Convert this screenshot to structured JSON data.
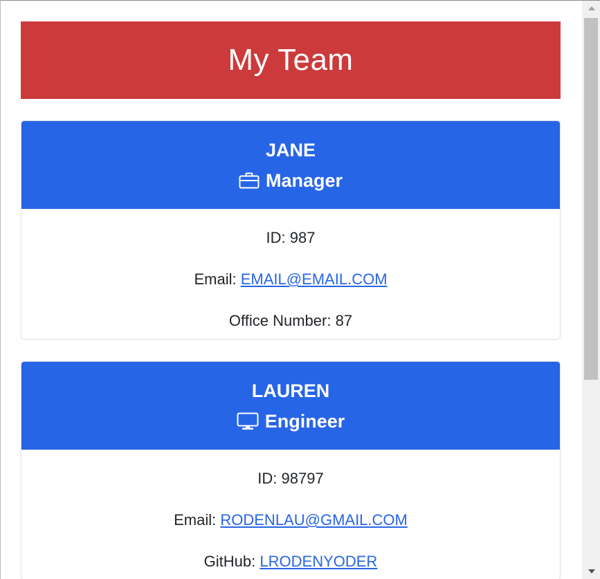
{
  "banner": {
    "title": "My Team"
  },
  "colors": {
    "banner": "#cc3a3b",
    "card_header": "#2765e7",
    "link": "#2765e7"
  },
  "cards": [
    {
      "name": "JANE",
      "role": "Manager",
      "role_icon": "briefcase-icon",
      "id_label": "ID:",
      "id": "987",
      "email_label": "Email:",
      "email": "EMAIL@EMAIL.COM",
      "office_label": "Office Number:",
      "office": "87"
    },
    {
      "name": "LAUREN",
      "role": "Engineer",
      "role_icon": "monitor-icon",
      "id_label": "ID:",
      "id": "98797",
      "email_label": "Email:",
      "email": "RODENLAU@GMAIL.COM",
      "github_label": "GitHub:",
      "github": "LRODENYODER"
    }
  ]
}
